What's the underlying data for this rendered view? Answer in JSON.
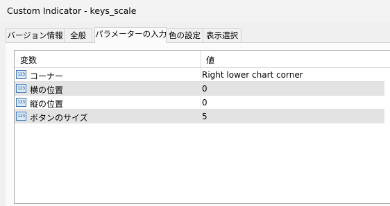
{
  "window": {
    "title": "Custom Indicator - keys_scale"
  },
  "tabs": [
    {
      "label": "バージョン情報"
    },
    {
      "label": "全般"
    },
    {
      "label": "パラメーターの入力"
    },
    {
      "label": "色の設定"
    },
    {
      "label": "表示選択"
    }
  ],
  "grid": {
    "headers": {
      "name": "変数",
      "value": "値"
    },
    "icon_text": "123",
    "rows": [
      {
        "name": "コーナー",
        "value": "Right lower chart corner",
        "icon": "integer-param-icon"
      },
      {
        "name": "横の位置",
        "value": "0",
        "icon": "integer-param-icon"
      },
      {
        "name": "縦の位置",
        "value": "0",
        "icon": "integer-param-icon"
      },
      {
        "name": "ボタンのサイズ",
        "value": "5",
        "icon": "integer-param-icon"
      }
    ]
  },
  "colors": {
    "row_alt": "#e3e3e3",
    "icon_border": "#3a78b8"
  }
}
